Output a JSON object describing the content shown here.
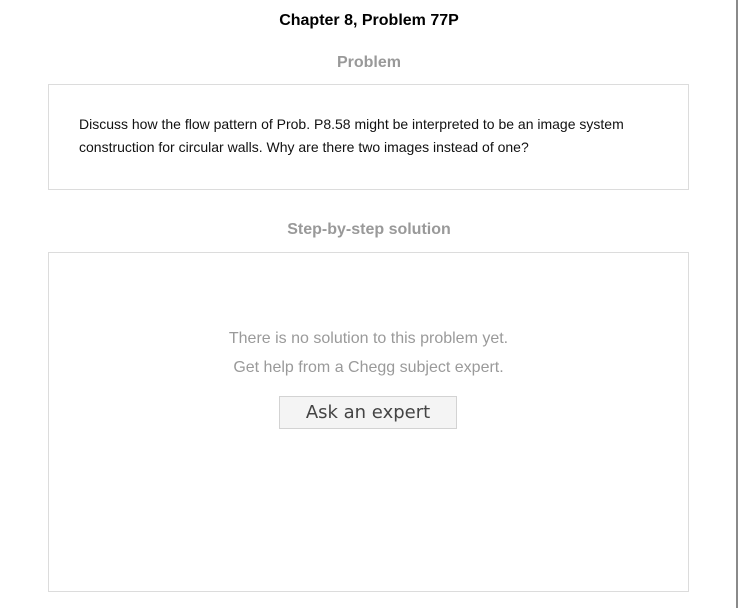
{
  "page": {
    "title": "Chapter 8, Problem 77P"
  },
  "problem": {
    "heading": "Problem",
    "text": "Discuss how the flow pattern of Prob. P8.58 might be interpreted to be an image system construction for circular walls. Why are there two images instead of one?"
  },
  "solution": {
    "heading": "Step-by-step solution",
    "empty_line1": "There is no solution to this problem yet.",
    "empty_line2": "Get help from a Chegg subject expert.",
    "ask_button_label": "Ask an expert"
  }
}
